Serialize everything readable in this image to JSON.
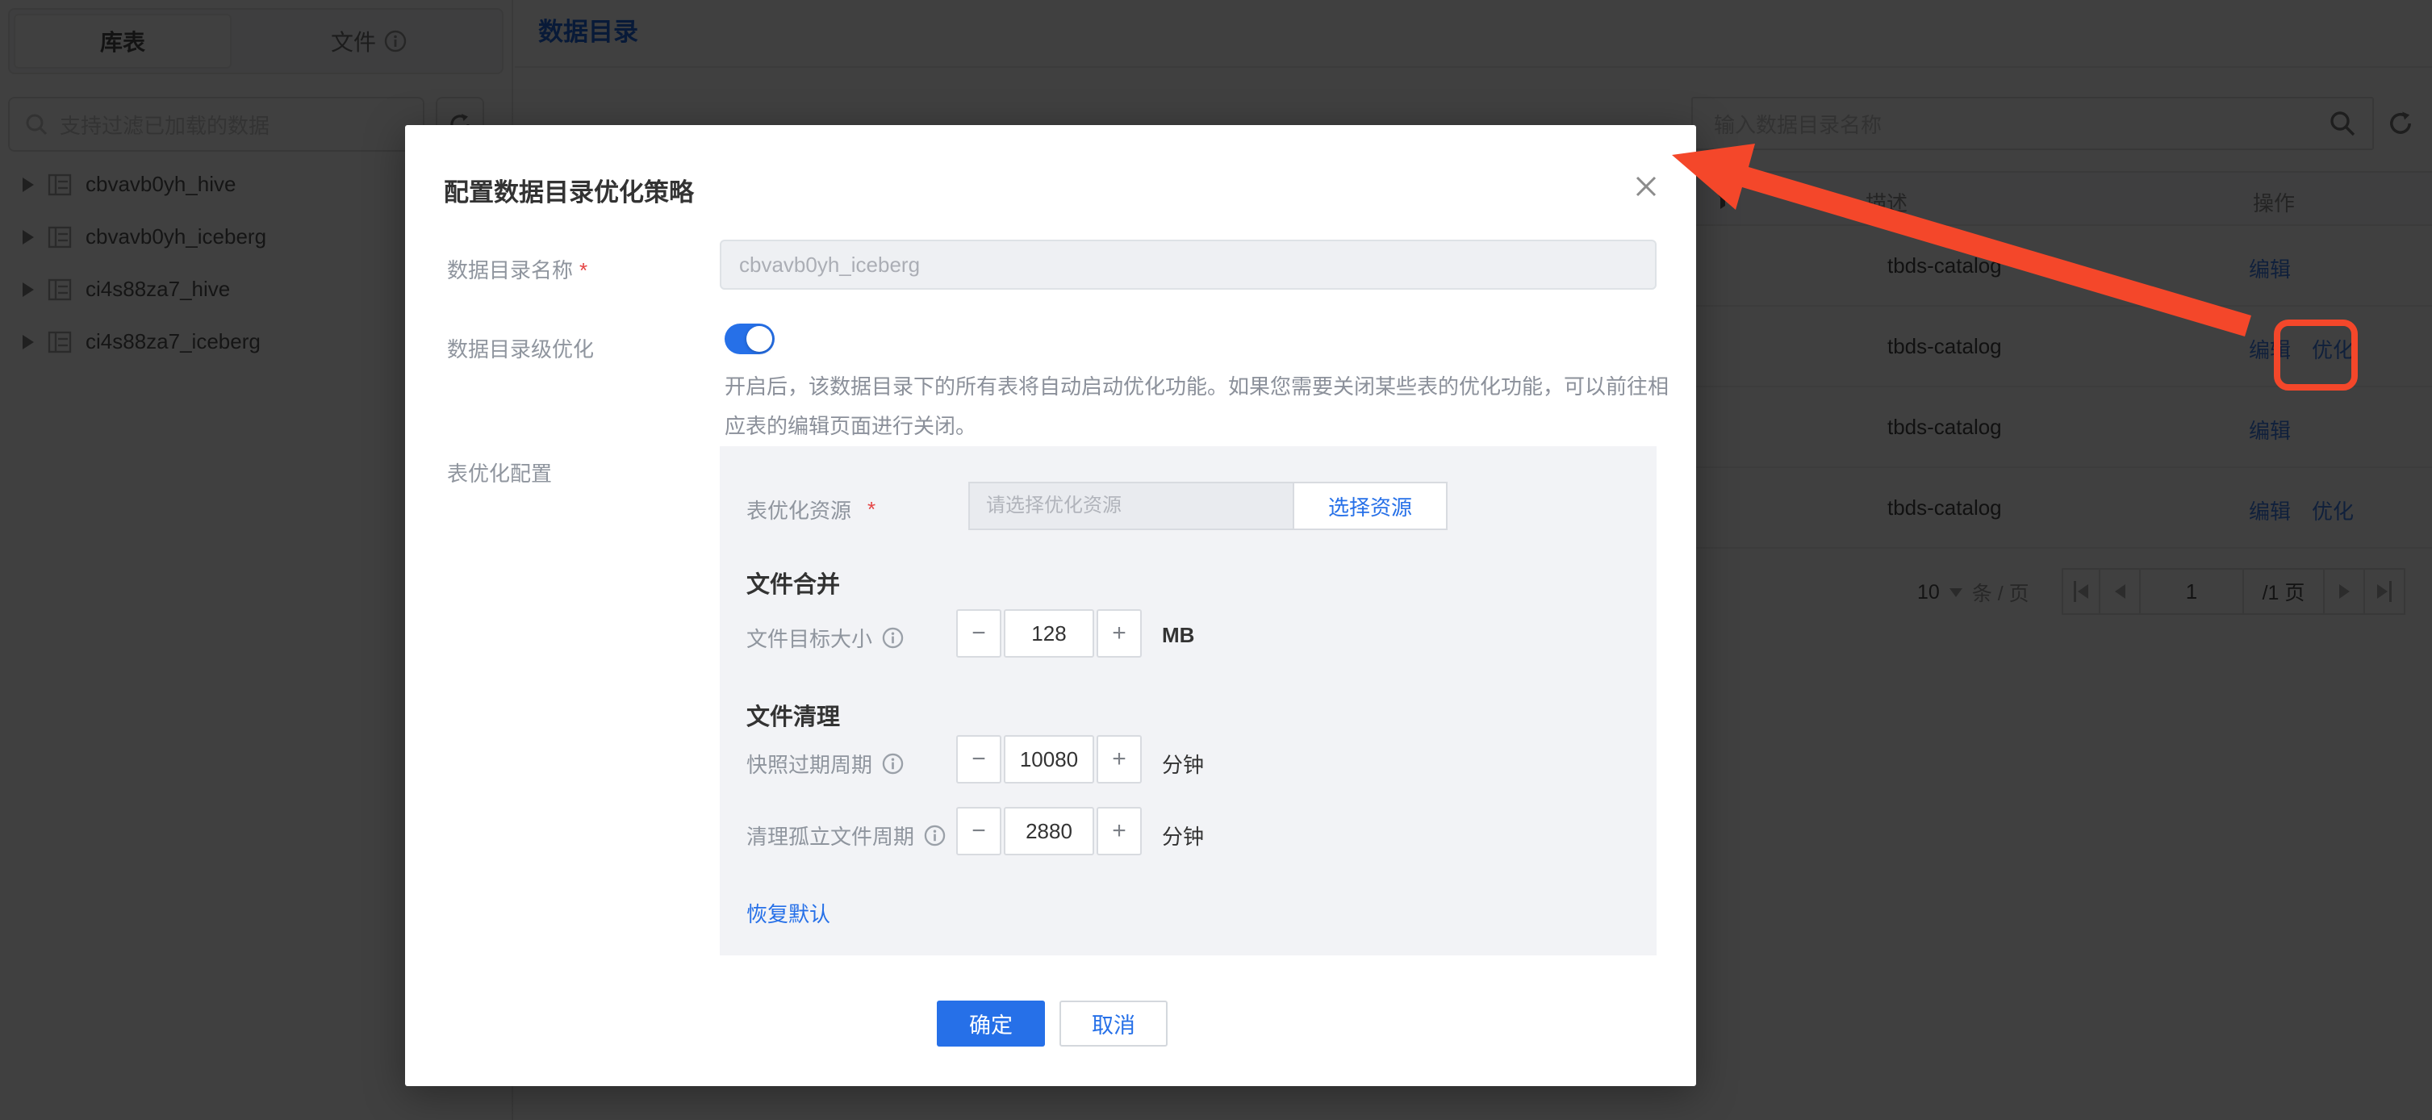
{
  "colors": {
    "accent": "#2670e8",
    "title_blue": "#0052d9",
    "annotation_red": "#f4472a"
  },
  "sidebar": {
    "tabs": [
      {
        "label": "库表"
      },
      {
        "label": "文件"
      }
    ],
    "search_placeholder": "支持过滤已加载的数据",
    "tree": [
      {
        "label": "cbvavb0yh_hive"
      },
      {
        "label": "cbvavb0yh_iceberg"
      },
      {
        "label": "ci4s88za7_hive"
      },
      {
        "label": "ci4s88za7_iceberg"
      }
    ]
  },
  "main": {
    "title": "数据目录",
    "search_placeholder": "输入数据目录名称",
    "table": {
      "columns": {
        "desc": "描述",
        "ops": "操作"
      },
      "rows": [
        {
          "desc": "tbds-catalog",
          "ops": [
            "编辑"
          ]
        },
        {
          "desc": "tbds-catalog",
          "ops": [
            "编辑",
            "优化"
          ]
        },
        {
          "desc": "tbds-catalog",
          "ops": [
            "编辑"
          ]
        },
        {
          "desc": "tbds-catalog",
          "ops": [
            "编辑",
            "优化"
          ]
        }
      ]
    },
    "pagination": {
      "page_size": "10",
      "page_size_suffix": "条 / 页",
      "current_page": "1",
      "total_label": "/1 页"
    }
  },
  "modal": {
    "title": "配置数据目录优化策略",
    "required_mark": "*",
    "catalog_name": {
      "label": "数据目录名称",
      "value": "cbvavb0yh_iceberg"
    },
    "catalog_opt": {
      "label": "数据目录级优化",
      "enabled": true,
      "description": "开启后，该数据目录下的所有表将自动启动优化功能。如果您需要关闭某些表的优化功能，可以前往相应表的编辑页面进行关闭。"
    },
    "table_opt": {
      "label": "表优化配置",
      "resource": {
        "label": "表优化资源",
        "placeholder": "请选择优化资源",
        "button": "选择资源"
      },
      "merge_heading": "文件合并",
      "target_size": {
        "label": "文件目标大小",
        "value": "128",
        "unit": "MB"
      },
      "clean_heading": "文件清理",
      "snapshot_expire": {
        "label": "快照过期周期",
        "value": "10080",
        "unit": "分钟"
      },
      "orphan_clean": {
        "label": "清理孤立文件周期",
        "value": "2880",
        "unit": "分钟"
      },
      "restore_default": "恢复默认",
      "stepper": {
        "minus": "−",
        "plus": "+"
      }
    },
    "confirm": "确定",
    "cancel": "取消"
  }
}
